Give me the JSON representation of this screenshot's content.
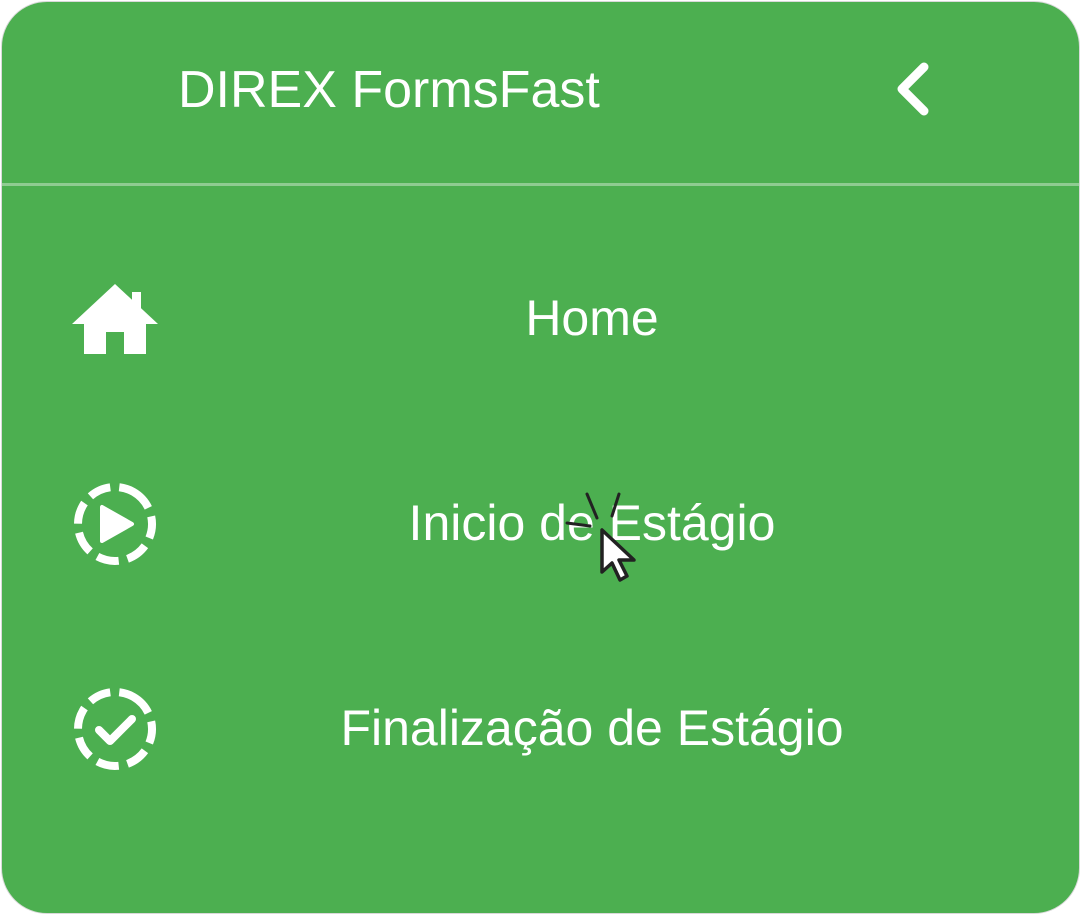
{
  "header": {
    "title": "DIREX FormsFast",
    "collapse_icon": "chevron-left-icon"
  },
  "nav": {
    "items": [
      {
        "label": "Home",
        "icon": "home-icon"
      },
      {
        "label": "Inicio de Estágio",
        "icon": "play-circle-dashed-icon"
      },
      {
        "label": "Finalização de Estágio",
        "icon": "check-circle-dashed-icon"
      }
    ]
  },
  "colors": {
    "background": "#4caf50",
    "text": "#ffffff",
    "divider": "#a5d6a7"
  }
}
